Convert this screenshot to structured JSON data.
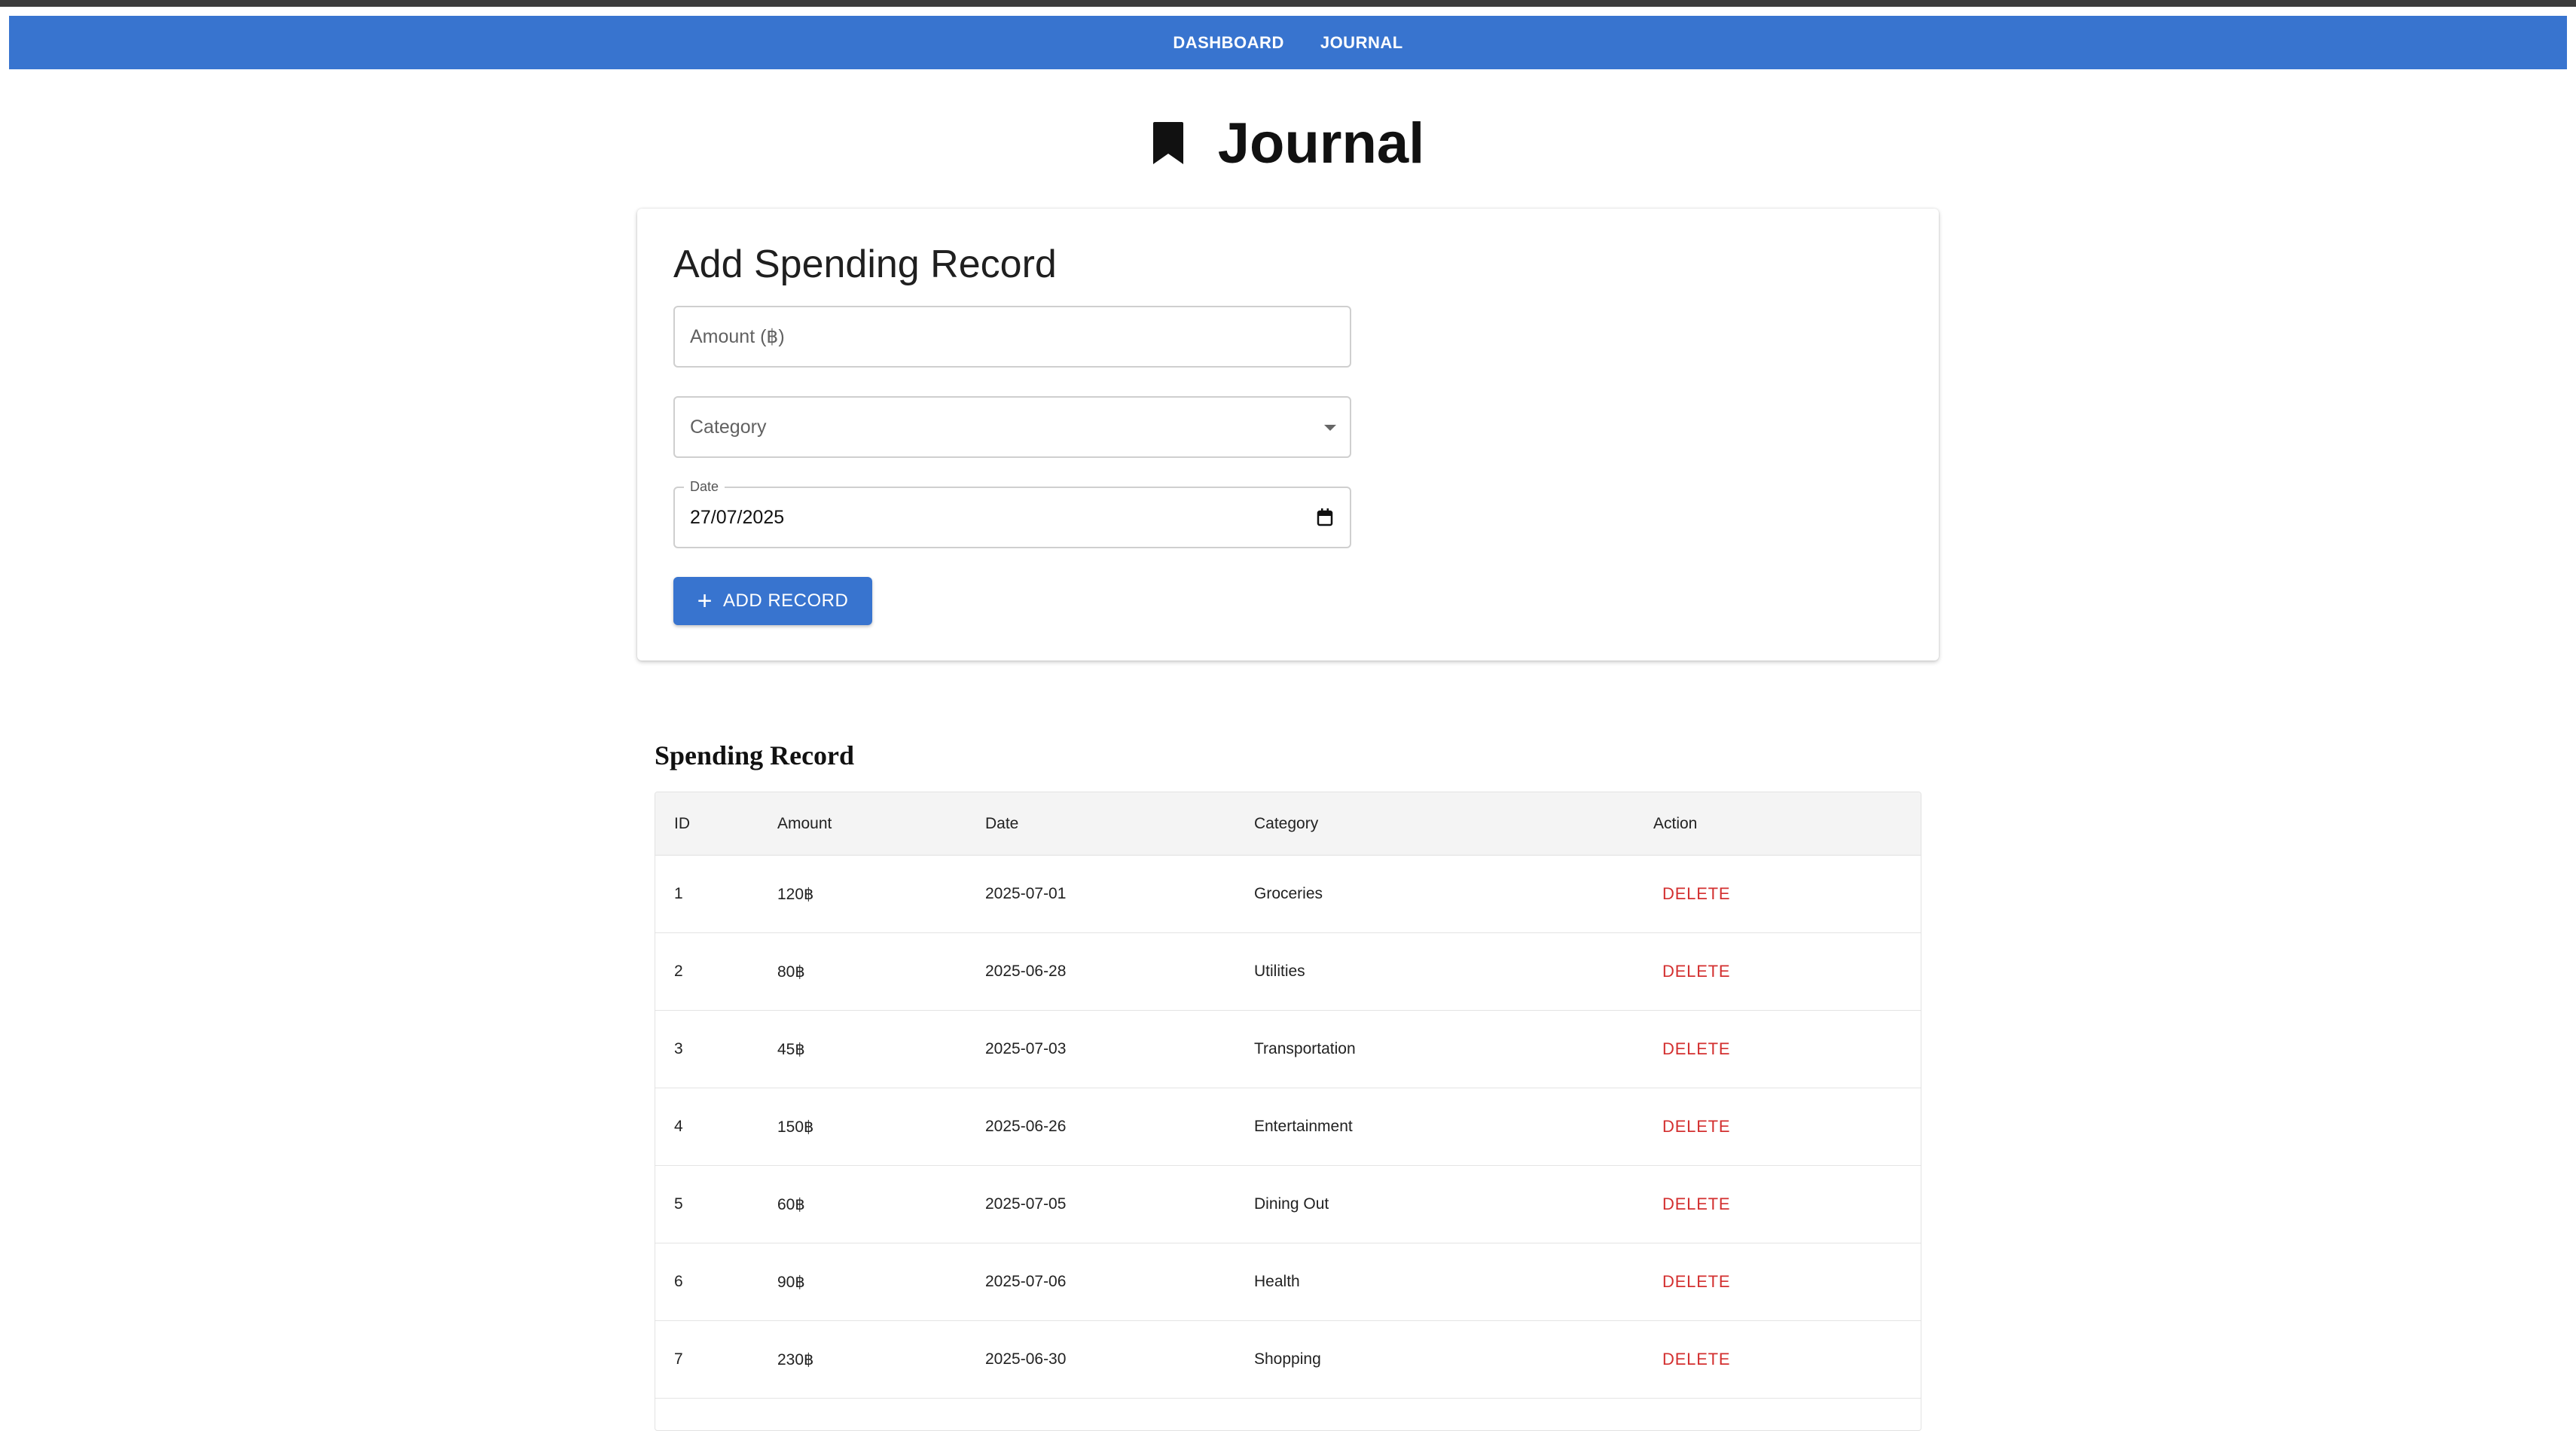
{
  "nav": {
    "links": [
      "DASHBOARD",
      "JOURNAL"
    ],
    "accent": "#3874cf"
  },
  "header": {
    "title": "Journal",
    "icon": "bookmark-icon"
  },
  "form": {
    "title": "Add Spending Record",
    "amount_placeholder": "Amount (฿)",
    "category_placeholder": "Category",
    "date_label": "Date",
    "date_value": "27/07/2025",
    "add_button_label": "ADD RECORD"
  },
  "table": {
    "title": "Spending Record",
    "columns": [
      "ID",
      "Amount",
      "Date",
      "Category",
      "Action"
    ],
    "rows": [
      {
        "id": "1",
        "amount": "120฿",
        "date": "2025-07-01",
        "category": "Groceries",
        "action": "DELETE"
      },
      {
        "id": "2",
        "amount": "80฿",
        "date": "2025-06-28",
        "category": "Utilities",
        "action": "DELETE"
      },
      {
        "id": "3",
        "amount": "45฿",
        "date": "2025-07-03",
        "category": "Transportation",
        "action": "DELETE"
      },
      {
        "id": "4",
        "amount": "150฿",
        "date": "2025-06-26",
        "category": "Entertainment",
        "action": "DELETE"
      },
      {
        "id": "5",
        "amount": "60฿",
        "date": "2025-07-05",
        "category": "Dining Out",
        "action": "DELETE"
      },
      {
        "id": "6",
        "amount": "90฿",
        "date": "2025-07-06",
        "category": "Health",
        "action": "DELETE"
      },
      {
        "id": "7",
        "amount": "230฿",
        "date": "2025-06-30",
        "category": "Shopping",
        "action": "DELETE"
      }
    ],
    "delete_color": "#d32f2f"
  }
}
